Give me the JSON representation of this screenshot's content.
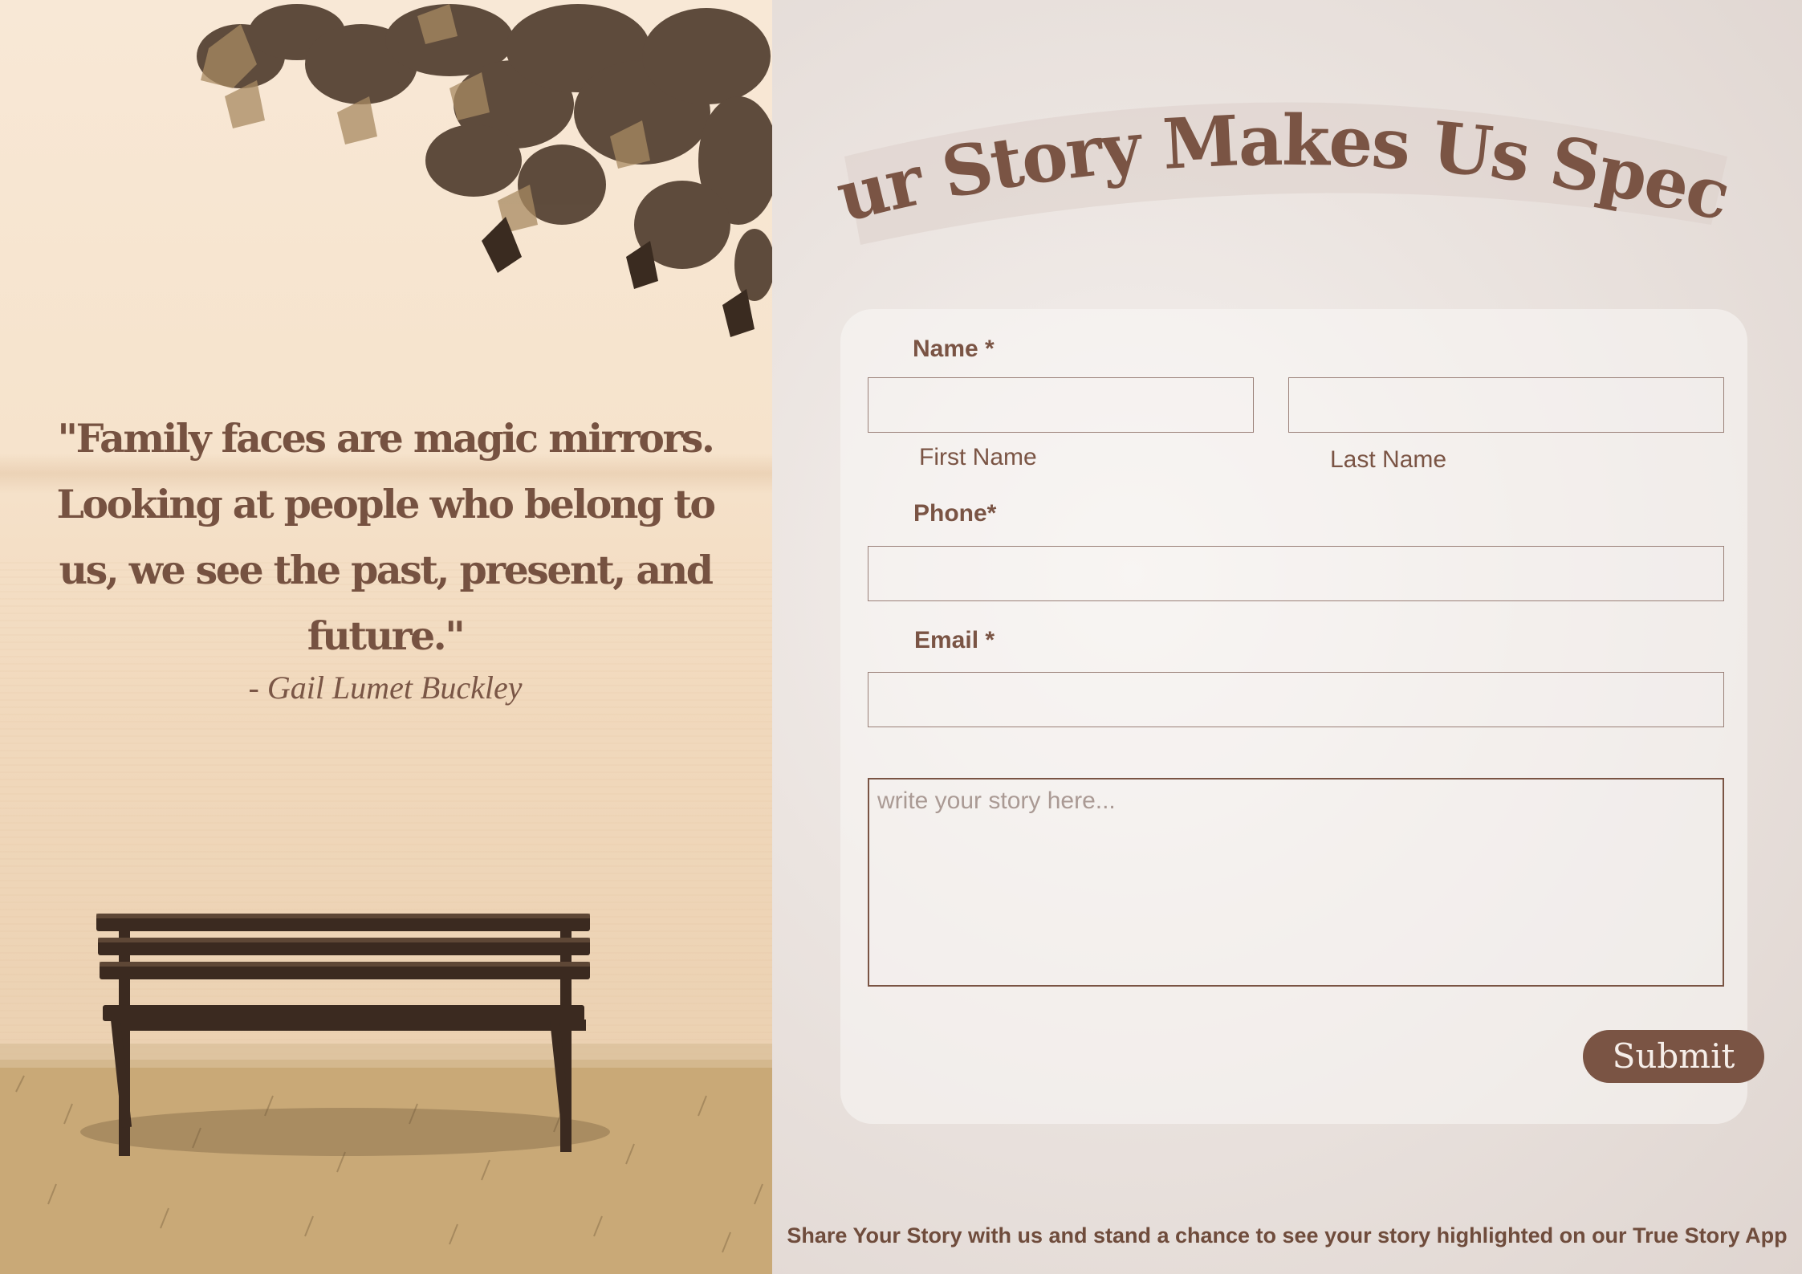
{
  "quote": {
    "text": "\"Family faces are magic mirrors. Looking at people who belong to us, we see the past, present, and future.\"",
    "author": "- Gail Lumet Buckley"
  },
  "header": {
    "title": "Your Story Makes Us Special"
  },
  "form": {
    "name_label": "Name *",
    "first_name_label": "First Name",
    "last_name_label": "Last Name",
    "first_name_value": "",
    "last_name_value": "",
    "phone_label": "Phone*",
    "phone_value": "",
    "email_label": "Email *",
    "email_value": "",
    "story_placeholder": "write your story here...",
    "submit_label": "Submit"
  },
  "footer": {
    "note": "Share Your Story with us and stand a chance to see your story highlighted on our True Story App"
  },
  "colors": {
    "accent": "#7a5444",
    "panel_background": "#e4dbd6",
    "photo_tone": "#f6e3cc"
  }
}
